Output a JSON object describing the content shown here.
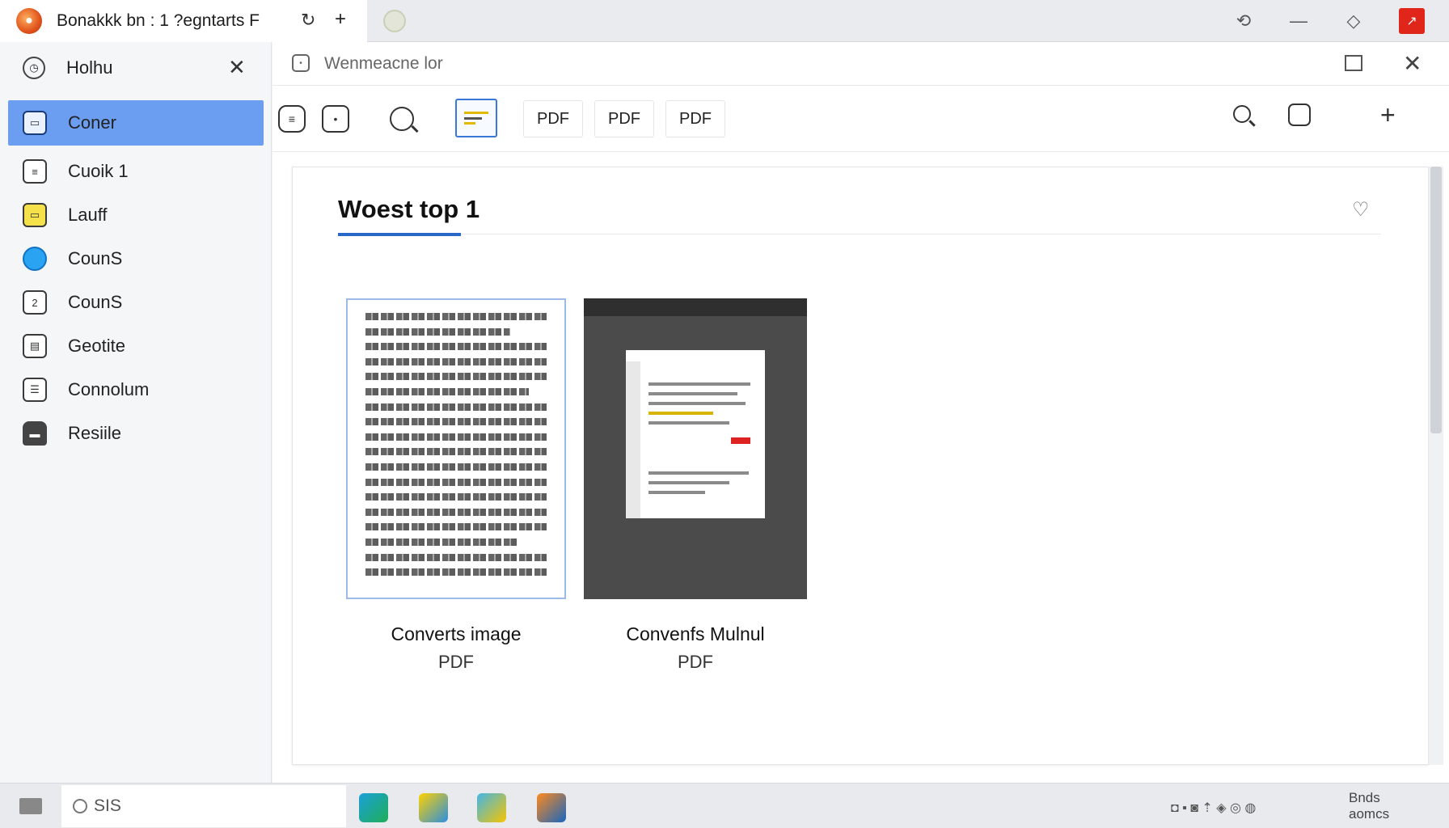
{
  "window": {
    "tab_title": "Bonakkk bn :  1 ?egntarts F",
    "accent_color": "#6b9ef0",
    "close_color": "#e0261a"
  },
  "sidebar": {
    "header_label": "Holhu",
    "items": [
      {
        "label": "Coner",
        "icon": "folder-icon",
        "active": true
      },
      {
        "label": "Cuoik 1",
        "icon": "calendar-icon",
        "active": false
      },
      {
        "label": "Lauff",
        "icon": "note-icon",
        "active": false
      },
      {
        "label": "CounS",
        "icon": "circle-icon",
        "active": false
      },
      {
        "label": "CounS",
        "icon": "page-icon",
        "active": false
      },
      {
        "label": "Geotite",
        "icon": "clipboard-icon",
        "active": false
      },
      {
        "label": "Connolum",
        "icon": "list-icon",
        "active": false
      },
      {
        "label": "Resiile",
        "icon": "printer-icon",
        "active": false
      }
    ]
  },
  "address_bar": {
    "text": "Wenmeacne lor"
  },
  "toolbar": {
    "pdf_buttons": [
      "PDF",
      "PDF",
      "PDF"
    ]
  },
  "panel": {
    "title": "Woest top 1",
    "cards": [
      {
        "title": "Converts image",
        "subtitle": "PDF"
      },
      {
        "title": "Convenfs Mulnul",
        "subtitle": "PDF"
      }
    ]
  },
  "taskbar": {
    "search_text": "SIS",
    "clock_line1": "Bnds",
    "clock_line2": "aomcs"
  }
}
